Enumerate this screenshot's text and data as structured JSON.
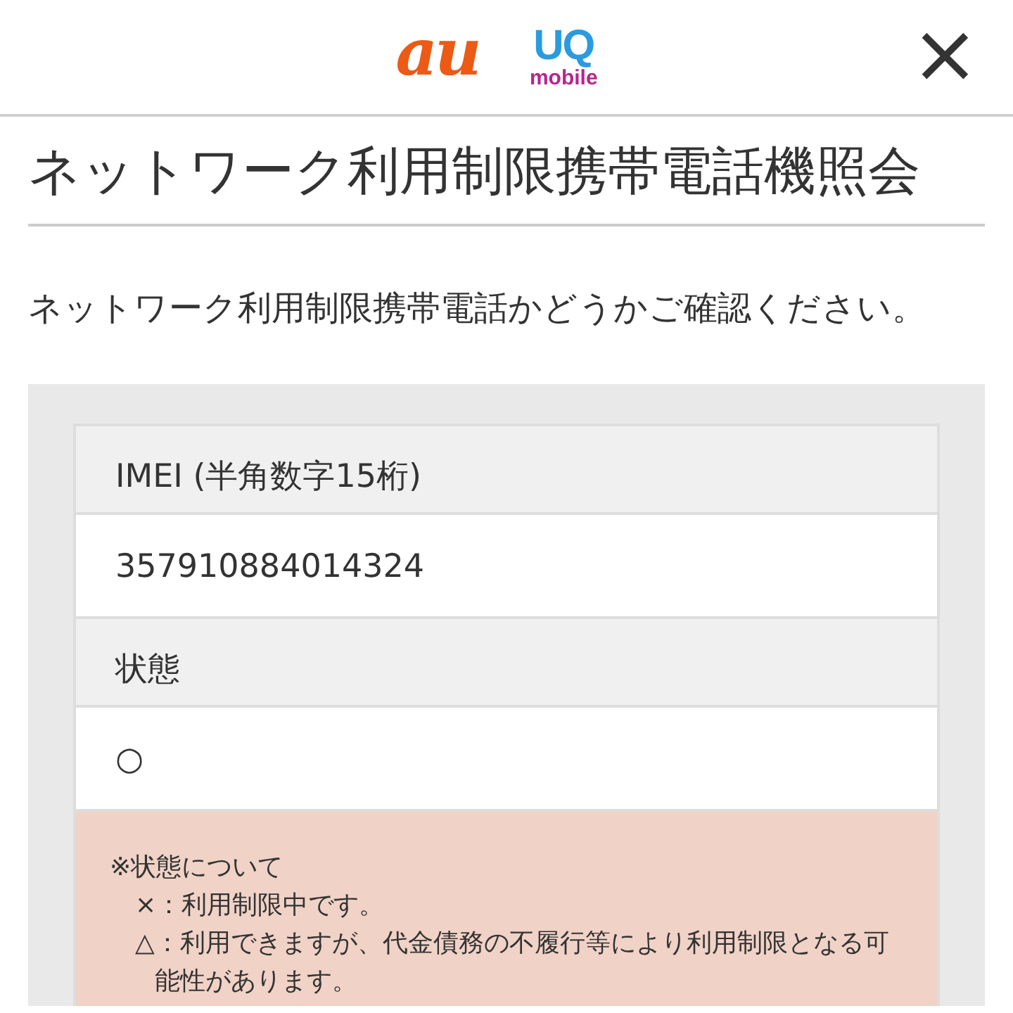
{
  "header": {
    "logos": [
      {
        "kind": "au",
        "text": "au"
      },
      {
        "kind": "uq",
        "text": "UQ",
        "subtext": "mobile"
      }
    ],
    "close": "×"
  },
  "title": "ネットワーク利用制限携帯電話機照会",
  "description": "ネットワーク利用制限携帯電話かどうかご確認ください。",
  "result": [
    {
      "label": "IMEI (半角数字15桁)",
      "value": "357910884014324"
    },
    {
      "label": "状態",
      "value": "○"
    }
  ],
  "note": {
    "heading": "※状態について",
    "items": [
      {
        "symbol": "×",
        "text": "：利用制限中です。"
      },
      {
        "symbol": "△",
        "text": "：利用できますが、代金債務の不履行等により利用制限となる可能性があります。"
      }
    ]
  }
}
